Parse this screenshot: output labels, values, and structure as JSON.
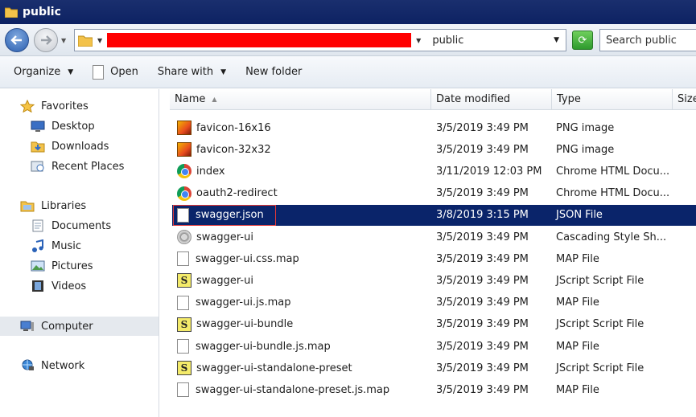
{
  "window": {
    "title": "public"
  },
  "address": {
    "crumb": "public",
    "search_placeholder": "Search public"
  },
  "toolbar": {
    "organize": "Organize",
    "open": "Open",
    "share_with": "Share with",
    "new_folder": "New folder"
  },
  "nav": {
    "favorites": "Favorites",
    "desktop": "Desktop",
    "downloads": "Downloads",
    "recent_places": "Recent Places",
    "libraries": "Libraries",
    "documents": "Documents",
    "music": "Music",
    "pictures": "Pictures",
    "videos": "Videos",
    "computer": "Computer",
    "network": "Network"
  },
  "columns": {
    "name": "Name",
    "date": "Date modified",
    "type": "Type",
    "size": "Size"
  },
  "files": [
    {
      "name": "favicon-16x16",
      "date": "3/5/2019 3:49 PM",
      "type": "PNG image",
      "icon": "png-image-icon"
    },
    {
      "name": "favicon-32x32",
      "date": "3/5/2019 3:49 PM",
      "type": "PNG image",
      "icon": "png-image-icon"
    },
    {
      "name": "index",
      "date": "3/11/2019 12:03 PM",
      "type": "Chrome HTML Docu...",
      "icon": "chrome-icon"
    },
    {
      "name": "oauth2-redirect",
      "date": "3/5/2019 3:49 PM",
      "type": "Chrome HTML Docu...",
      "icon": "chrome-icon"
    },
    {
      "name": "swagger.json",
      "date": "3/8/2019 3:15 PM",
      "type": "JSON File",
      "icon": "file-icon"
    },
    {
      "name": "swagger-ui",
      "date": "3/5/2019 3:49 PM",
      "type": "Cascading Style Sh...",
      "icon": "css-icon"
    },
    {
      "name": "swagger-ui.css.map",
      "date": "3/5/2019 3:49 PM",
      "type": "MAP File",
      "icon": "file-icon"
    },
    {
      "name": "swagger-ui",
      "date": "3/5/2019 3:49 PM",
      "type": "JScript Script File",
      "icon": "jscript-icon"
    },
    {
      "name": "swagger-ui.js.map",
      "date": "3/5/2019 3:49 PM",
      "type": "MAP File",
      "icon": "file-icon"
    },
    {
      "name": "swagger-ui-bundle",
      "date": "3/5/2019 3:49 PM",
      "type": "JScript Script File",
      "icon": "jscript-icon"
    },
    {
      "name": "swagger-ui-bundle.js.map",
      "date": "3/5/2019 3:49 PM",
      "type": "MAP File",
      "icon": "file-icon"
    },
    {
      "name": "swagger-ui-standalone-preset",
      "date": "3/5/2019 3:49 PM",
      "type": "JScript Script File",
      "icon": "jscript-icon"
    },
    {
      "name": "swagger-ui-standalone-preset.js.map",
      "date": "3/5/2019 3:49 PM",
      "type": "MAP File",
      "icon": "file-icon"
    }
  ],
  "selected_file": "swagger.json",
  "colors": {
    "selection": "#0a246a",
    "highlight_box": "#e23838",
    "redaction": "#ff0000"
  }
}
